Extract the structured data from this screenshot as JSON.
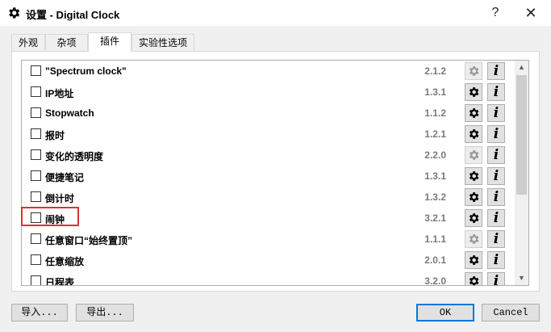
{
  "window": {
    "title": "设置 - Digital Clock",
    "help_label": "?",
    "close_label": "✕",
    "app_icon": "gear-icon"
  },
  "tabs": [
    {
      "label": "外观",
      "active": false
    },
    {
      "label": "杂项",
      "active": false
    },
    {
      "label": "插件",
      "active": true
    },
    {
      "label": "实验性选项",
      "active": false
    }
  ],
  "plugins": [
    {
      "name": "\"Spectrum clock\"",
      "version": "2.1.2",
      "checked": false,
      "settings_enabled": false
    },
    {
      "name": "IP地址",
      "version": "1.3.1",
      "checked": false,
      "settings_enabled": true
    },
    {
      "name": "Stopwatch",
      "version": "1.1.2",
      "checked": false,
      "settings_enabled": true
    },
    {
      "name": "报时",
      "version": "1.2.1",
      "checked": false,
      "settings_enabled": true
    },
    {
      "name": "变化的透明度",
      "version": "2.2.0",
      "checked": false,
      "settings_enabled": false
    },
    {
      "name": "便捷笔记",
      "version": "1.3.1",
      "checked": false,
      "settings_enabled": true
    },
    {
      "name": "倒计时",
      "version": "1.3.2",
      "checked": false,
      "settings_enabled": true
    },
    {
      "name": "闹钟",
      "version": "3.2.1",
      "checked": false,
      "settings_enabled": true
    },
    {
      "name": "任意窗口“始终置顶”",
      "version": "1.1.1",
      "checked": false,
      "settings_enabled": false
    },
    {
      "name": "任意缩放",
      "version": "2.0.1",
      "checked": false,
      "settings_enabled": true
    },
    {
      "name": "日程表",
      "version": "3.2.0",
      "checked": false,
      "settings_enabled": true
    }
  ],
  "info_label": "i",
  "buttons": {
    "import": "导入...",
    "export": "导出...",
    "ok": "OK",
    "cancel": "Cancel"
  },
  "colors": {
    "highlight": "#e03030",
    "default_button_border": "#0078d7"
  }
}
